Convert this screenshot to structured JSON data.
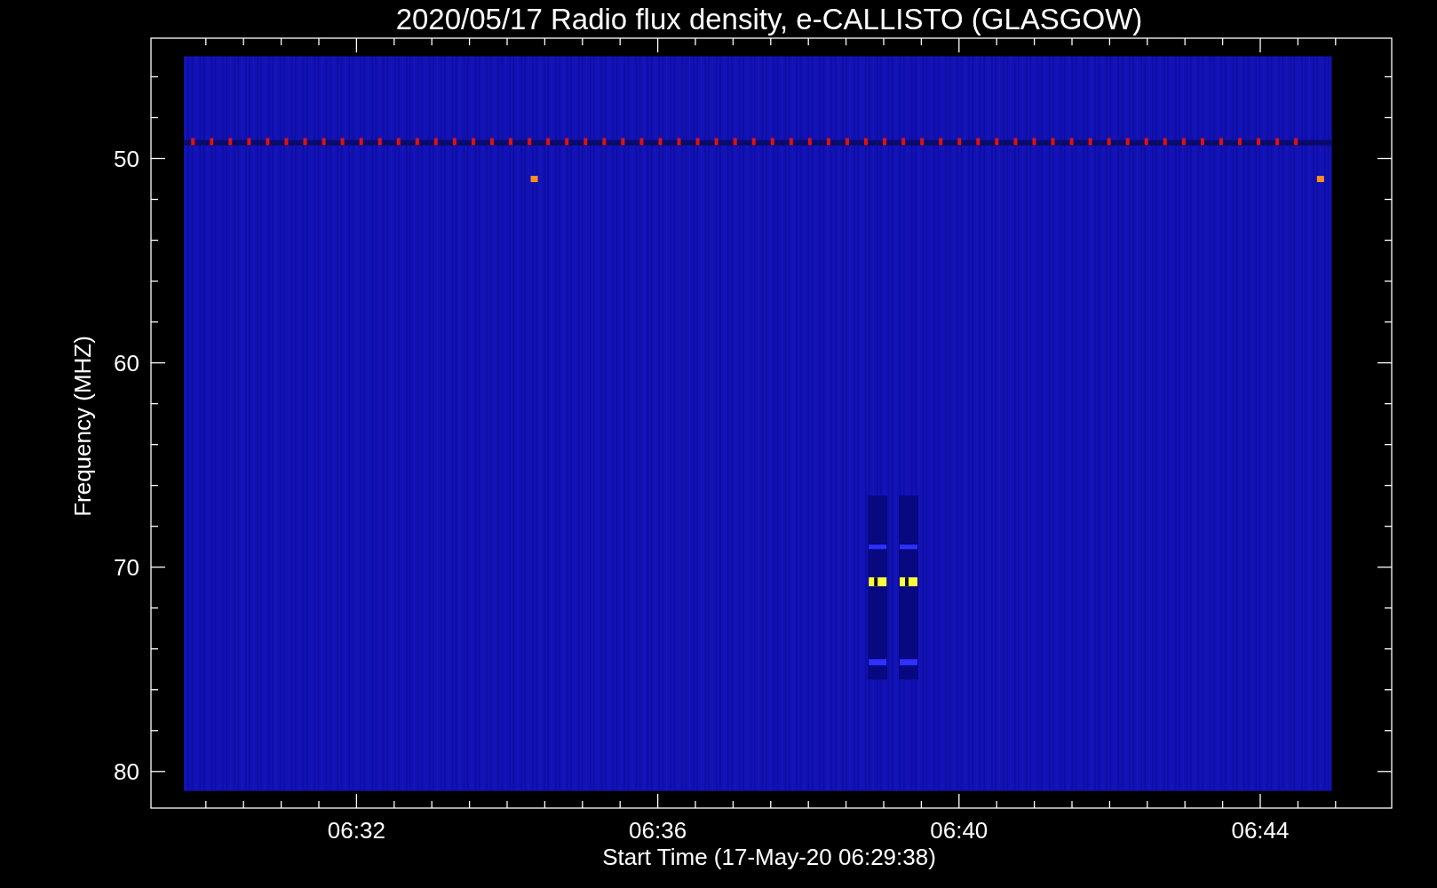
{
  "title": "2020/05/17  Radio flux density, e-CALLISTO (GLASGOW)",
  "y_axis": {
    "label": "Frequency (MHZ)",
    "ticks": [
      "50",
      "60",
      "70",
      "80"
    ]
  },
  "x_axis": {
    "label": "Start Time (17-May-20 06:29:38)",
    "ticks": [
      "06:32",
      "06:36",
      "06:40",
      "06:44"
    ]
  }
}
